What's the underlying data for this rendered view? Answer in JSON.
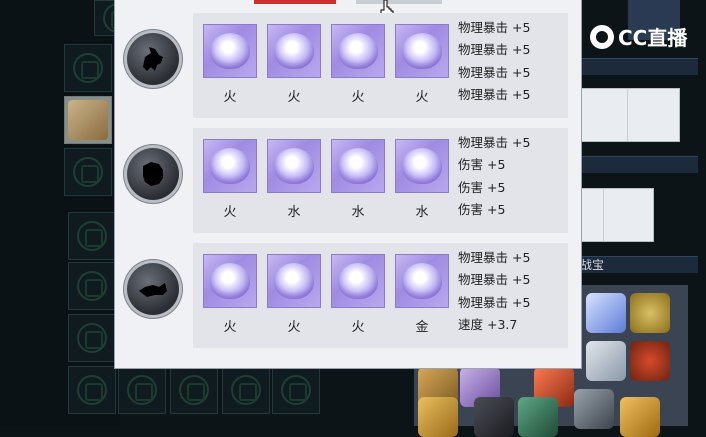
{
  "watermark": {
    "brand": "CC直播"
  },
  "background": {
    "right_bar_label": "战宝"
  },
  "dialog": {
    "rows": [
      {
        "pet_icon": "dragon-silhouette-icon",
        "gems": [
          {
            "element": "火"
          },
          {
            "element": "火"
          },
          {
            "element": "火"
          },
          {
            "element": "火"
          }
        ],
        "stats": [
          "物理暴击 +5",
          "物理暴击 +5",
          "物理暴击 +5",
          "物理暴击 +5"
        ]
      },
      {
        "pet_icon": "beast-silhouette-icon",
        "gems": [
          {
            "element": "火"
          },
          {
            "element": "水"
          },
          {
            "element": "水"
          },
          {
            "element": "水"
          }
        ],
        "stats": [
          "物理暴击 +5",
          "伤害 +5",
          "伤害 +5",
          "伤害 +5"
        ]
      },
      {
        "pet_icon": "fish-silhouette-icon",
        "gems": [
          {
            "element": "火"
          },
          {
            "element": "火"
          },
          {
            "element": "火"
          },
          {
            "element": "金"
          }
        ],
        "stats": [
          "物理暴击 +5",
          "物理暴击 +5",
          "物理暴击 +5",
          "速度 +3.7"
        ]
      }
    ]
  },
  "colors": {
    "tab_active": "#c9322e",
    "gem_slot": "#b3a2ec",
    "dialog_bg": "#f0f1f4",
    "row_bg": "#e2e4ea"
  }
}
